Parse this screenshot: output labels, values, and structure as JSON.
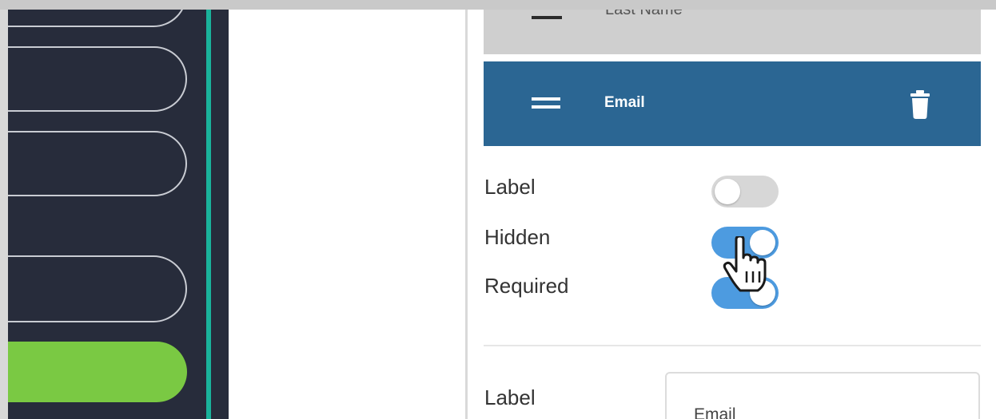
{
  "sidebar": {
    "pills": [
      "",
      "",
      "",
      ""
    ],
    "primary_button": ""
  },
  "fields": [
    {
      "label": "Last Name",
      "state": "collapsed"
    },
    {
      "label": "Email",
      "state": "selected"
    }
  ],
  "field_settings": {
    "toggles": [
      {
        "label": "Label",
        "on": false
      },
      {
        "label": "Hidden",
        "on": true
      },
      {
        "label": "Required",
        "on": true
      }
    ],
    "label_input": {
      "label": "Label",
      "value": "Email"
    }
  },
  "colors": {
    "sidebar_bg": "#272c3b",
    "accent": "#1ab39b",
    "primary_button": "#7ac943",
    "selected_field": "#2b6693",
    "toggle_on": "#4d9be0",
    "toggle_off": "#d7d7d7"
  },
  "icons": {
    "drag_handle": "drag-handle-icon",
    "delete": "trash-icon",
    "cursor": "hand-pointer-cursor"
  }
}
